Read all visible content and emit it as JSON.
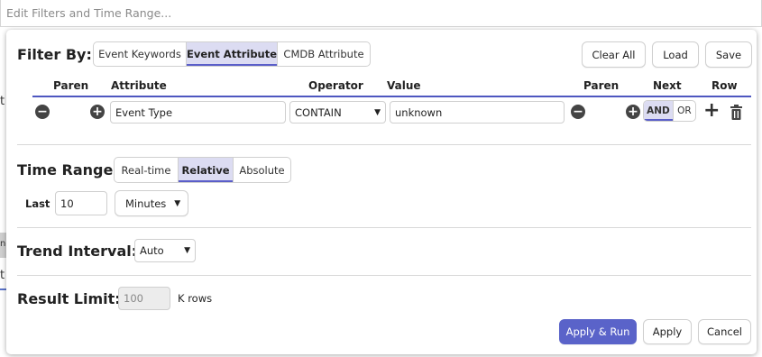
{
  "search": {
    "placeholder": "Edit Filters and Time Range..."
  },
  "background": {
    "fragments": [
      "t",
      "nc",
      "t"
    ]
  },
  "filter": {
    "title": "Filter By:",
    "tabs": [
      "Event Keywords",
      "Event Attribute",
      "CMDB Attribute"
    ],
    "active_tab": "Event Attribute",
    "actions": {
      "clear_all": "Clear All",
      "load": "Load",
      "save": "Save"
    },
    "columns": {
      "paren_open": "Paren",
      "attribute": "Attribute",
      "operator": "Operator",
      "value": "Value",
      "paren_close": "Paren",
      "next": "Next",
      "row": "Row"
    },
    "row": {
      "attribute": "Event Type",
      "operator": "CONTAIN",
      "value": "unknown",
      "next_options": [
        "AND",
        "OR"
      ],
      "next_selected": "AND"
    }
  },
  "time_range": {
    "title": "Time Range:",
    "tabs": [
      "Real-time",
      "Relative",
      "Absolute"
    ],
    "active_tab": "Relative",
    "last_label": "Last",
    "last_value": "10",
    "unit": "Minutes"
  },
  "trend": {
    "title": "Trend Interval:",
    "value": "Auto"
  },
  "result_limit": {
    "title": "Result Limit:",
    "placeholder": "100",
    "unit": "K rows"
  },
  "footer": {
    "apply_run": "Apply & Run",
    "apply": "Apply",
    "cancel": "Cancel"
  },
  "colors": {
    "accent": "#5a63c9",
    "active_tab_bg": "#dcdcf2",
    "rule": "#4e57c0"
  }
}
